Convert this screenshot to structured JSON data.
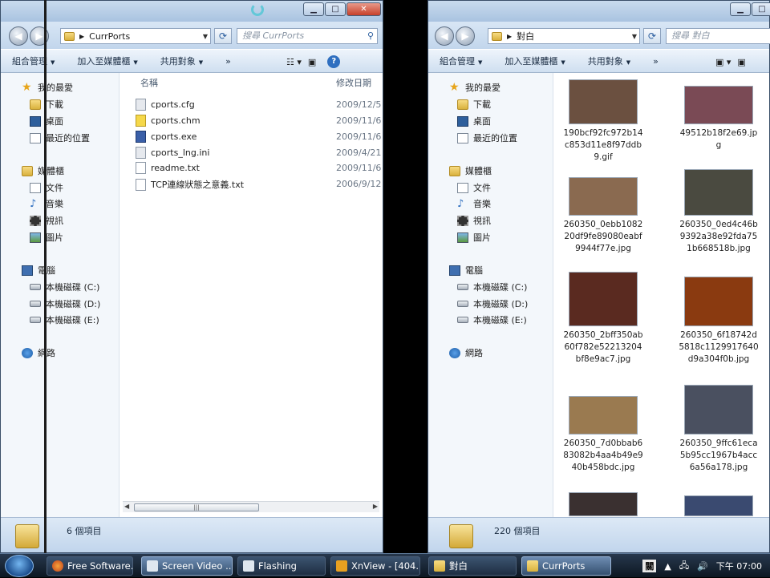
{
  "left_window": {
    "address": "CurrPorts",
    "search_placeholder": "搜尋 CurrPorts",
    "toolbar": {
      "organize": "組合管理",
      "add_to_library": "加入至媒體櫃",
      "share": "共用對象",
      "more": "»"
    },
    "nav": {
      "favorites": "我的最愛",
      "downloads": "下載",
      "desktop": "桌面",
      "recent": "最近的位置",
      "libraries": "媒體櫃",
      "documents": "文件",
      "music": "音樂",
      "videos": "視訊",
      "pictures": "圖片",
      "computer": "電腦",
      "drive_c": "本機磁碟 (C:)",
      "drive_d": "本機磁碟 (D:)",
      "drive_e": "本機磁碟 (E:)",
      "network": "網路"
    },
    "columns": {
      "name": "名稱",
      "date": "修改日期"
    },
    "files": [
      {
        "name": "cports.cfg",
        "date": "2009/12/5"
      },
      {
        "name": "cports.chm",
        "date": "2009/11/6"
      },
      {
        "name": "cports.exe",
        "date": "2009/11/6"
      },
      {
        "name": "cports_lng.ini",
        "date": "2009/4/21"
      },
      {
        "name": "readme.txt",
        "date": "2009/11/6"
      },
      {
        "name": "TCP連線狀態之意義.txt",
        "date": "2006/9/12"
      }
    ],
    "status": "6 個項目"
  },
  "right_window": {
    "address": "對白",
    "search_placeholder": "搜尋 對白",
    "toolbar": {
      "organize": "組合管理",
      "add_to_library": "加入至媒體櫃",
      "share": "共用對象",
      "more": "»"
    },
    "thumbnails": [
      {
        "name": "190bcf92fc972b14c853d11e8f97ddb9.gif",
        "color": "#6b5040"
      },
      {
        "name": "49512b18f2e69.jpg",
        "color": "#7a4a55"
      },
      {
        "name": "260350_0ebb108220df9fe89080eabf9944f77e.jpg",
        "color": "#8a6a50"
      },
      {
        "name": "260350_0ed4c46b9392a38e92fda751b668518b.jpg",
        "color": "#4a4a40"
      },
      {
        "name": "260350_2bff350ab60f782e52213204bf8e9ac7.jpg",
        "color": "#5a2a20"
      },
      {
        "name": "260350_6f18742d5818c1129917640d9a304f0b.jpg",
        "color": "#8a3a10"
      },
      {
        "name": "260350_7d0bbab683082b4aa4b49e940b458bdc.jpg",
        "color": "#9a7a50"
      },
      {
        "name": "260350_9ffc61eca5b95cc1967b4acc6a56a178.jpg",
        "color": "#4a5060"
      }
    ],
    "status": "220 個項目"
  },
  "taskbar": {
    "items": [
      "Free Software...",
      "Screen Video ...",
      "Flashing",
      "XnView - [404...",
      "對白",
      "CurrPorts"
    ],
    "ime": "關",
    "clock": "下午 07:00"
  }
}
